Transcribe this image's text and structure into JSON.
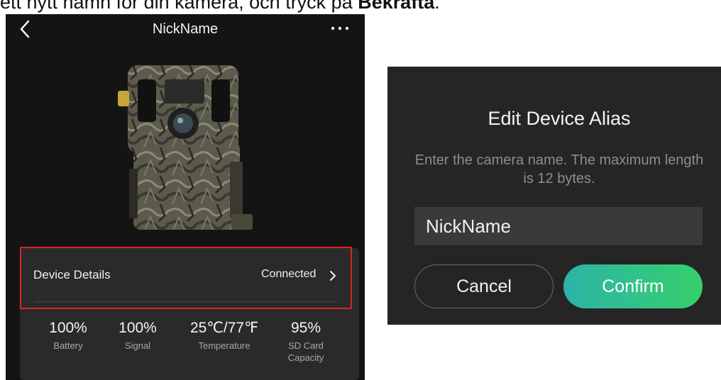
{
  "caption": {
    "text_before": "ett nytt namn för din kamera, och tryck på ",
    "text_bold": "Bekräfta",
    "text_after": "."
  },
  "phone": {
    "title": "NickName",
    "device_details_label": "Device Details",
    "device_status": "Connected",
    "stats": [
      {
        "value": "100%",
        "label": "Battery"
      },
      {
        "value": "100%",
        "label": "Signal"
      },
      {
        "value": "25℃/77℉",
        "label": "Temperature"
      },
      {
        "value": "95%",
        "label": "SD Card Capacity"
      }
    ]
  },
  "dialog": {
    "title": "Edit Device Alias",
    "description": "Enter the camera name. The maximum length is 12 bytes.",
    "input_value": "NickName",
    "cancel_label": "Cancel",
    "confirm_label": "Confirm"
  },
  "colors": {
    "highlight": "#d9271f",
    "confirm_start": "#2cb3a8",
    "confirm_end": "#36d06a"
  }
}
